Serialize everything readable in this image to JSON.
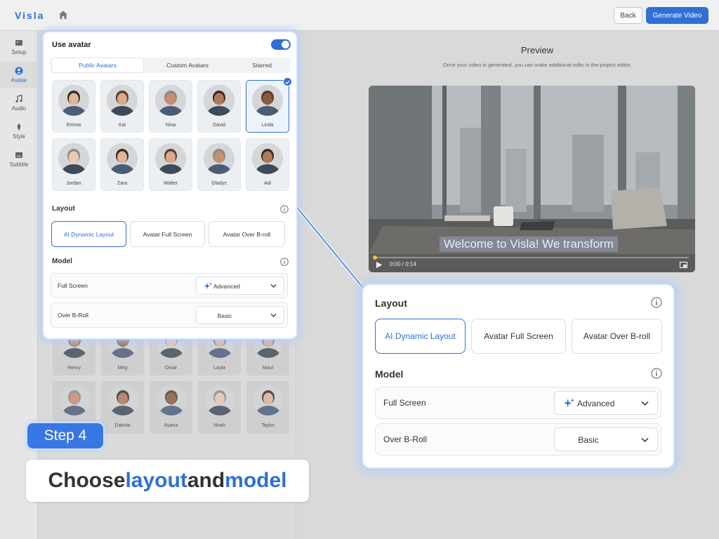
{
  "app": {
    "logo": "Visla"
  },
  "header": {
    "back_label": "Back",
    "generate_label": "Generate Video"
  },
  "sidebar": {
    "items": [
      {
        "label": "Setup",
        "icon": "image-icon"
      },
      {
        "label": "Avatar",
        "icon": "user-icon",
        "active": true
      },
      {
        "label": "Audio",
        "icon": "music-icon"
      },
      {
        "label": "Style",
        "icon": "style-icon"
      },
      {
        "label": "Subtitle",
        "icon": "subtitle-icon"
      }
    ]
  },
  "preview": {
    "title": "Preview",
    "subtitle": "Once your video is generated, you can make additional edits in the project editor.",
    "caption": "Welcome to Visla! We transform",
    "time": "0:00 / 0:14",
    "progress": 0
  },
  "panel": {
    "use_avatar_label": "Use avatar",
    "use_avatar_on": true,
    "tabs": [
      {
        "label": "Public Avatars",
        "active": true
      },
      {
        "label": "Custom Avatars"
      },
      {
        "label": "Starred"
      }
    ],
    "avatars": [
      {
        "name": "Emma"
      },
      {
        "name": "Kai"
      },
      {
        "name": "Nina"
      },
      {
        "name": "David"
      },
      {
        "name": "Linda",
        "selected": true
      },
      {
        "name": "Jordan"
      },
      {
        "name": "Zara"
      },
      {
        "name": "Walter"
      },
      {
        "name": "Gladys"
      },
      {
        "name": "Adi"
      }
    ],
    "layout_title": "Layout",
    "layout_options": [
      {
        "label": "AI Dynamic Layout",
        "active": true
      },
      {
        "label": "Avatar Full Screen"
      },
      {
        "label": "Avatar Over B-roll"
      }
    ],
    "model_title": "Model",
    "model_rows": [
      {
        "label": "Full Screen",
        "value": "Advanced",
        "sparkle": true
      },
      {
        "label": "Over B-Roll",
        "value": "Basic"
      }
    ]
  },
  "background_avatars": [
    {
      "name": "Henry"
    },
    {
      "name": "Meg"
    },
    {
      "name": "Omar"
    },
    {
      "name": "Layla"
    },
    {
      "name": "Maul"
    },
    {
      "name": ""
    },
    {
      "name": "Dakota"
    },
    {
      "name": "Ayana"
    },
    {
      "name": "Noah"
    },
    {
      "name": "Taylor"
    }
  ],
  "zoom": {
    "layout_title": "Layout",
    "layout_options": [
      {
        "label": "AI Dynamic Layout",
        "active": true
      },
      {
        "label": "Avatar Full Screen"
      },
      {
        "label": "Avatar Over B-roll"
      }
    ],
    "model_title": "Model",
    "model_rows": [
      {
        "label": "Full Screen",
        "value": "Advanced"
      },
      {
        "label": "Over B-Roll",
        "value": "Basic"
      }
    ]
  },
  "tutorial": {
    "step_label": "Step 4",
    "headline_parts": [
      "Choose ",
      "layout",
      " and ",
      "model"
    ]
  },
  "colors": {
    "accent": "#2f6fd6",
    "step_bg": "#3777e3"
  }
}
